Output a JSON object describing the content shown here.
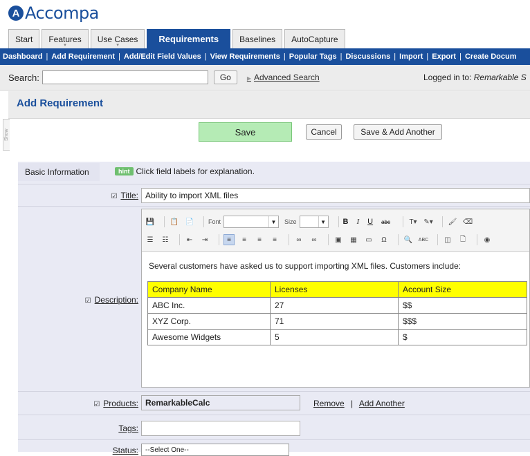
{
  "app": {
    "logo_mark": "A",
    "logo_text": "Accompa"
  },
  "tabs": [
    {
      "label": "Start"
    },
    {
      "label": "Features"
    },
    {
      "label": "Use Cases"
    },
    {
      "label": "Requirements"
    },
    {
      "label": "Baselines"
    },
    {
      "label": "AutoCapture"
    }
  ],
  "subnav": [
    "Dashboard",
    "Add Requirement",
    "Add/Edit Field Values",
    "View Requirements",
    "Popular Tags",
    "Discussions",
    "Import",
    "Export",
    "Create Docum"
  ],
  "search": {
    "label": "Search:",
    "value": "",
    "go_label": "Go",
    "advanced_label": "Advanced Search",
    "logged_prefix": "Logged in to: ",
    "logged_account": "Remarkable S"
  },
  "page": {
    "title": "Add Requirement",
    "show_tab": "Show"
  },
  "buttons": {
    "save": "Save",
    "cancel": "Cancel",
    "save_add": "Save & Add Another"
  },
  "form": {
    "tab_label": "Basic Information",
    "hint_badge": "hint",
    "hint_text": "Click field labels for explanation.",
    "title_label": "Title:",
    "title_value": "Ability to import XML files",
    "description_label": "Description:",
    "products_label": "Products:",
    "products_value": "RemarkableCalc",
    "remove_label": "Remove",
    "add_another_label": "Add Another",
    "tags_label": "Tags:",
    "tags_value": "",
    "status_label": "Status:",
    "status_value": "--Select One--"
  },
  "editor": {
    "font_label": "Font",
    "size_label": "Size",
    "bold": "B",
    "italic": "I",
    "underline": "U",
    "strike": "abc",
    "spell": "ABC",
    "body_text": "Several customers have asked us to support importing XML files. Customers include:",
    "table": {
      "headers": [
        "Company Name",
        "Licenses",
        "Account Size"
      ],
      "rows": [
        [
          "ABC Inc.",
          "27",
          "$$"
        ],
        [
          "XYZ Corp.",
          "71",
          "$$$"
        ],
        [
          "Awesome Widgets",
          "5",
          "$"
        ]
      ]
    }
  },
  "colors": {
    "brand_blue": "#1a4f9c",
    "save_green": "#b5ebb5",
    "table_header": "#ffff00",
    "hint_green": "#6fbf6f"
  }
}
